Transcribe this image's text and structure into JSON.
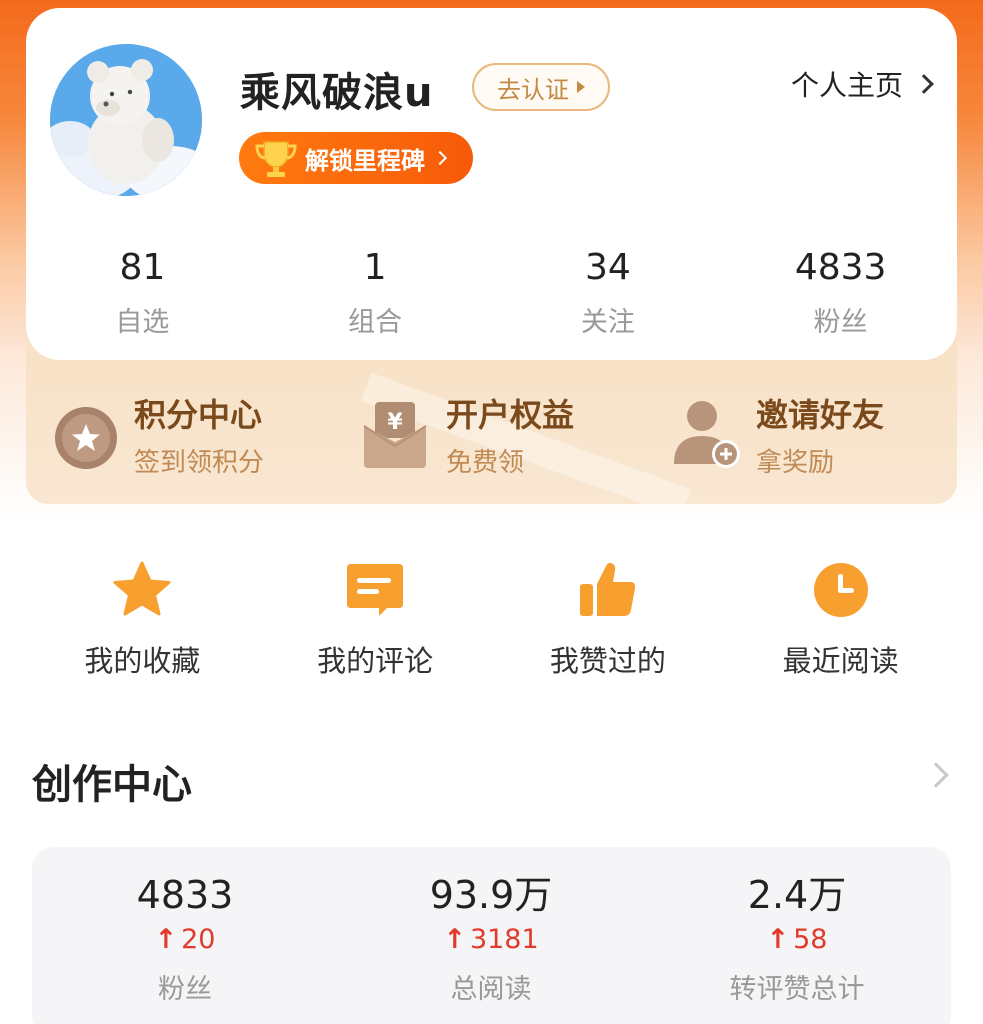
{
  "profile": {
    "username": "乘风破浪u",
    "verify_label": "去认证",
    "homepage_label": "个人主页",
    "milestone_label": "解锁里程碑",
    "stats": [
      {
        "value": "81",
        "label": "自选"
      },
      {
        "value": "1",
        "label": "组合"
      },
      {
        "value": "34",
        "label": "关注"
      },
      {
        "value": "4833",
        "label": "粉丝"
      }
    ]
  },
  "benefits": [
    {
      "title": "积分中心",
      "subtitle": "签到领积分",
      "icon": "star-badge-icon"
    },
    {
      "title": "开户权益",
      "subtitle": "免费领",
      "icon": "yuan-envelope-icon"
    },
    {
      "title": "邀请好友",
      "subtitle": "拿奖励",
      "icon": "add-user-icon"
    }
  ],
  "quick_actions": [
    {
      "label": "我的收藏",
      "icon": "star-icon"
    },
    {
      "label": "我的评论",
      "icon": "comment-icon"
    },
    {
      "label": "我赞过的",
      "icon": "thumbs-up-icon"
    },
    {
      "label": "最近阅读",
      "icon": "clock-icon"
    }
  ],
  "creation_center": {
    "title": "创作中心",
    "stats": [
      {
        "value": "4833",
        "delta": "20",
        "label": "粉丝"
      },
      {
        "value": "93.9万",
        "delta": "3181",
        "label": "总阅读"
      },
      {
        "value": "2.4万",
        "delta": "58",
        "label": "转评赞总计"
      }
    ]
  },
  "colors": {
    "accent_orange": "#f75a09",
    "benefit_title": "#7a4a1d",
    "delta_red": "#e23a2b",
    "icon_orange": "#f7a030"
  }
}
